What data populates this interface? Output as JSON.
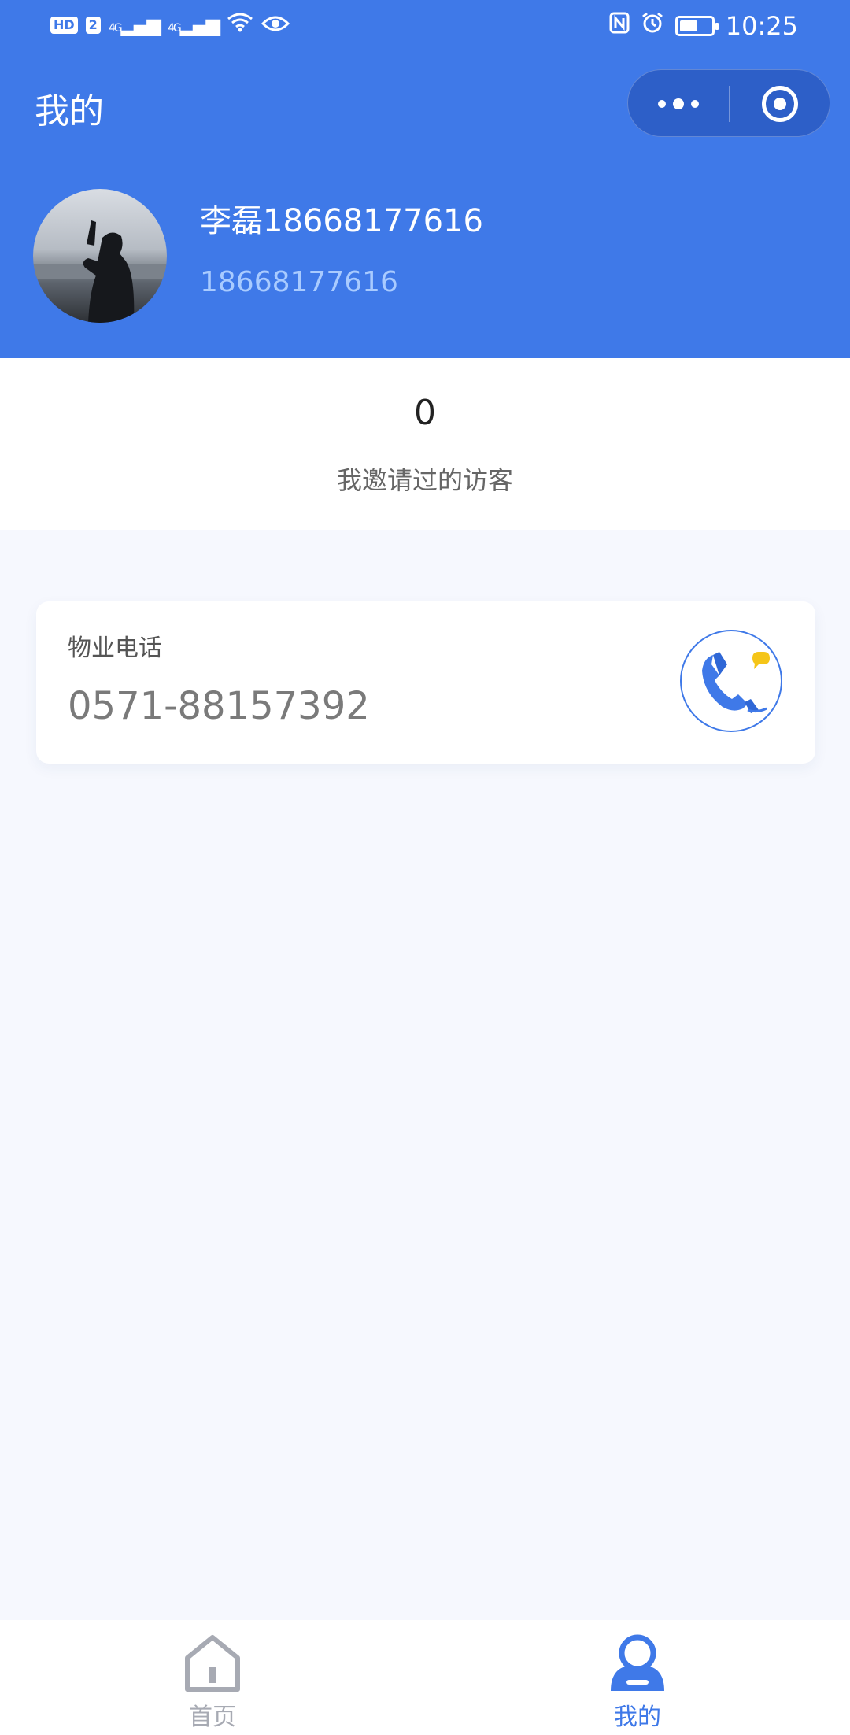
{
  "status_bar": {
    "left_badge": "HD",
    "left_badge_num": "2",
    "signal_1": "4G",
    "signal_2": "4G",
    "time": "10:25",
    "icons": [
      "nfc-icon",
      "alarm-icon",
      "battery-icon",
      "wifi-icon",
      "eye-icon"
    ]
  },
  "header": {
    "title": "我的",
    "capsule": {
      "more_icon": "more-dots-icon",
      "close_icon": "target-close-icon"
    }
  },
  "profile": {
    "name": "李磊18668177616",
    "phone": "18668177616"
  },
  "stats": {
    "count": "0",
    "label": "我邀请过的访客"
  },
  "property_card": {
    "label": "物业电话",
    "number": "0571-88157392",
    "call_icon": "phone-call-icon"
  },
  "tabbar": {
    "tabs": [
      {
        "label": "首页",
        "icon": "home-icon",
        "active": false
      },
      {
        "label": "我的",
        "icon": "user-icon",
        "active": true
      }
    ]
  },
  "colors": {
    "primary": "#3f79e8",
    "phone_light": "#a9cbff",
    "accent_yellow": "#f5c518",
    "page_bg": "#f6f8fe"
  }
}
